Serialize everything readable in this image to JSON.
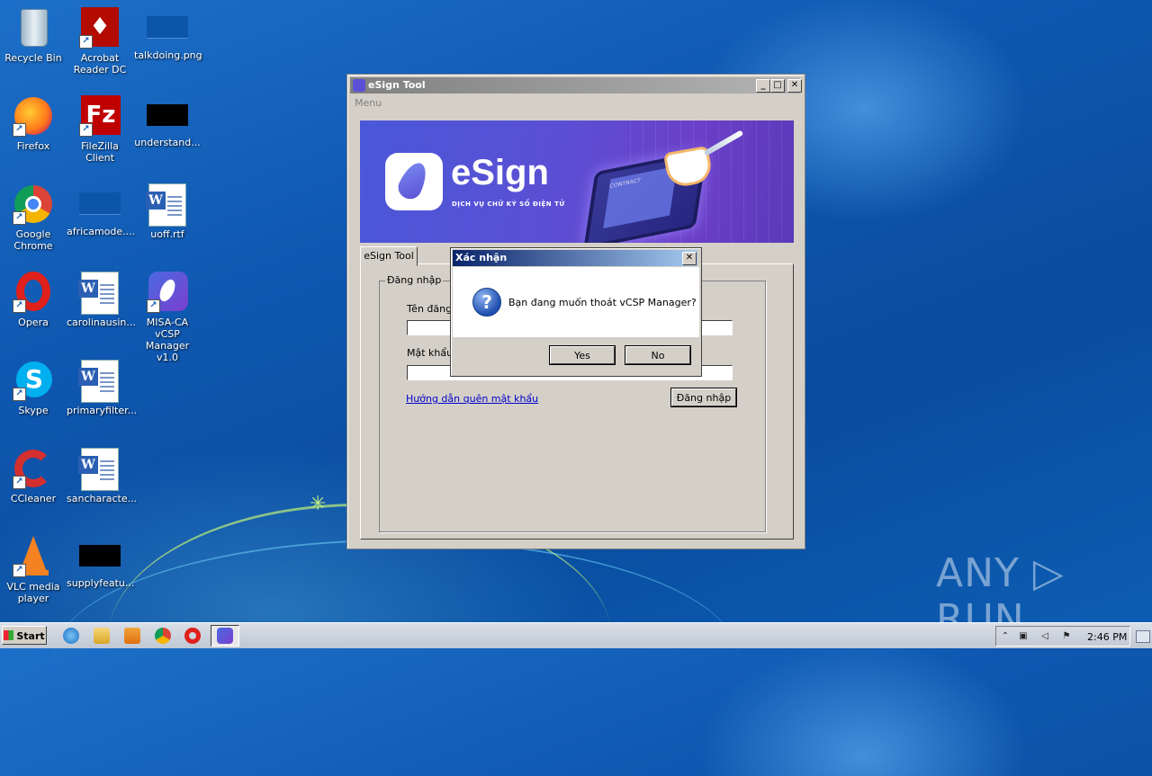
{
  "desktop": {
    "icons": [
      {
        "label": "Recycle Bin"
      },
      {
        "label": "Acrobat Reader DC"
      },
      {
        "label": "talkdoing.png"
      },
      {
        "label": "Firefox"
      },
      {
        "label": "FileZilla Client"
      },
      {
        "label": "understand..."
      },
      {
        "label": "Google Chrome"
      },
      {
        "label": "africamode...."
      },
      {
        "label": "uoff.rtf"
      },
      {
        "label": "Opera"
      },
      {
        "label": "carolinausin..."
      },
      {
        "label": "MISA-CA vCSP Manager v1.0"
      },
      {
        "label": "Skype"
      },
      {
        "label": "primaryfilter..."
      },
      {
        "label": "CCleaner"
      },
      {
        "label": "sancharacte..."
      },
      {
        "label": "VLC media player"
      },
      {
        "label": "supplyfeatu..."
      }
    ]
  },
  "window": {
    "title": "eSign Tool",
    "menu": "Menu",
    "controls": {
      "minimize": "_",
      "maximize": "□",
      "close": "✕"
    },
    "banner": {
      "brand": "eSign",
      "tagline": "DỊCH VỤ CHỮ KÝ SỐ ĐIỆN TỬ",
      "tablet_text": "CONTRACT"
    },
    "tab_label": "eSign Tool",
    "login": {
      "group_label": "Đăng nhập",
      "username_label": "Tên đăng nhập",
      "username_value": "",
      "password_label": "Mật khẩu",
      "password_value": "",
      "forgot_link": "Hướng dẫn quên mật khẩu",
      "login_button": "Đăng nhập"
    }
  },
  "dialog": {
    "title": "Xác nhận",
    "close": "✕",
    "message": "Bạn đang muốn thoát vCSP Manager?",
    "icon_glyph": "?",
    "yes": "Yes",
    "no": "No"
  },
  "taskbar": {
    "start": "Start",
    "clock": "2:46 PM"
  },
  "watermark": "ANY ▷ RUN",
  "colors": {
    "dialog_title": "#0a246a",
    "window_inactive_title": "#808080",
    "brand_purple": "#5b4fd4"
  }
}
